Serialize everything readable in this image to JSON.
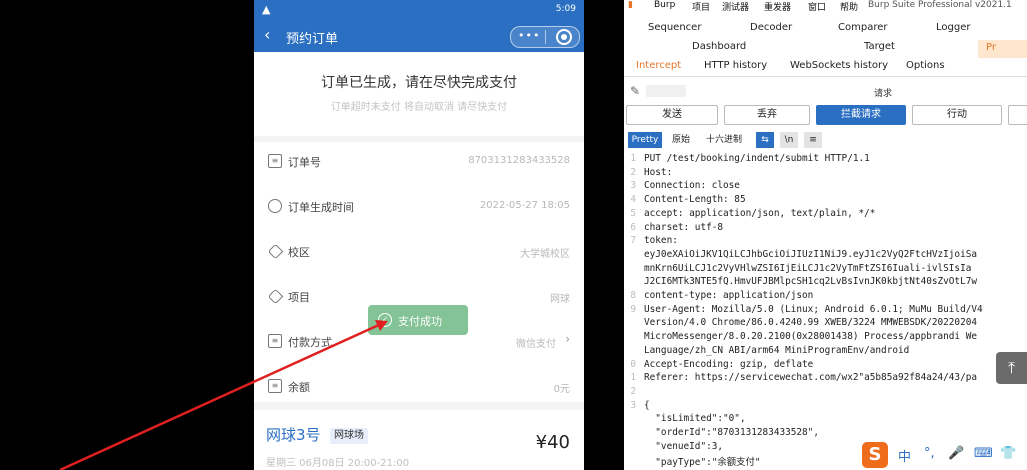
{
  "phone": {
    "status_time": "5:09",
    "header_title": "预约订单",
    "notice_message": "订单已生成，请在尽快完成支付",
    "notice_sub": "订单超时未支付 将自动取消 请尽快支付",
    "rows": [
      {
        "label": "订单号",
        "value": "8703131283433528",
        "icon": "doc-icon"
      },
      {
        "label": "订单生成时间",
        "value": "2022-05-27 18:05",
        "icon": "clock-icon"
      },
      {
        "label": "校区",
        "value": "大学城校区",
        "icon": "tag-icon"
      },
      {
        "label": "项目",
        "value": "网球",
        "icon": "tag-icon"
      },
      {
        "label": "付款方式",
        "value": "微信支付",
        "icon": "doc-icon"
      },
      {
        "label": "余额",
        "value": "0元",
        "icon": "doc-icon"
      }
    ],
    "toast": "支付成功",
    "court_name": "网球3号",
    "court_tag": "网球场",
    "price": "¥40",
    "booking_time": "星期三 06月08日 20:00-21:00"
  },
  "burp": {
    "menu": [
      "Burp",
      "项目",
      "测试器",
      "重发器",
      "窗口",
      "帮助",
      "Burp Suite Professional v2021.1"
    ],
    "tabs_row1": [
      "Sequencer",
      "Decoder",
      "Comparer",
      "Logger"
    ],
    "tabs_row2": [
      "Dashboard",
      "Target",
      "Pr"
    ],
    "subtabs": [
      "Intercept",
      "HTTP history",
      "WebSockets history",
      "Options"
    ],
    "request_note": "请求",
    "buttons": [
      "发送",
      "丢弃",
      "拦截请求",
      "行动"
    ],
    "view_buttons": [
      "Pretty",
      "原始",
      "十六进制"
    ],
    "code_lines": [
      {
        "n": "1",
        "t": "PUT /test/booking/indent/submit HTTP/1.1"
      },
      {
        "n": "2",
        "t": "Host: "
      },
      {
        "n": "3",
        "t": "Connection: close"
      },
      {
        "n": "4",
        "t": "Content-Length: 85"
      },
      {
        "n": "5",
        "t": "accept: application/json, text/plain, */*"
      },
      {
        "n": "6",
        "t": "charset: utf-8"
      },
      {
        "n": "7",
        "t": "token:"
      },
      {
        "n": "",
        "t": "eyJ0eXAiOiJKV1QiLCJhbGciOiJIUzI1NiJ9.eyJ1c2VyQ2FtcHVzIjoiSa"
      },
      {
        "n": "",
        "t": "mnKrn6UiLCJ1c2VyVHlwZSI6IjEiLCJ1c2VyTmFtZSI6Iuali-ivlSIsIa"
      },
      {
        "n": "",
        "t": "J2CI6MTk3NTE5fQ.HmvUFJBMlpcSH1cq2LvBsIvnJK0kbjtNt40sZvOtL7w"
      },
      {
        "n": "8",
        "t": "content-type: application/json"
      },
      {
        "n": "9",
        "t": "User-Agent: Mozilla/5.0 (Linux; Android 6.0.1; MuMu Build/V4"
      },
      {
        "n": "",
        "t": "Version/4.0 Chrome/86.0.4240.99 XWEB/3224 MMWEBSDK/20220204"
      },
      {
        "n": "",
        "t": "MicroMessenger/8.0.20.2100(0x28001438) Process/appbrandi We"
      },
      {
        "n": "",
        "t": "Language/zh_CN ABI/arm64 MiniProgramEnv/android"
      },
      {
        "n": "0",
        "t": "Accept-Encoding: gzip, deflate"
      },
      {
        "n": "1",
        "t": "Referer: https://servicewechat.com/wx2\"a5b85a92f84a24/43/pa"
      },
      {
        "n": "2",
        "t": ""
      },
      {
        "n": "3",
        "t": "{"
      },
      {
        "n": "",
        "t": "  \"isLimited\":\"0\","
      },
      {
        "n": "",
        "t": "  \"orderId\":\"8703131283433528\","
      },
      {
        "n": "",
        "t": "  \"venueId\":3,"
      },
      {
        "n": "",
        "t": "  \"payType\":\"余额支付\""
      }
    ]
  },
  "ime": {
    "logo": "S",
    "items": [
      "中",
      "°,",
      "🎤",
      "⌨",
      "👕"
    ]
  },
  "scroll_top_glyph": "⤒"
}
